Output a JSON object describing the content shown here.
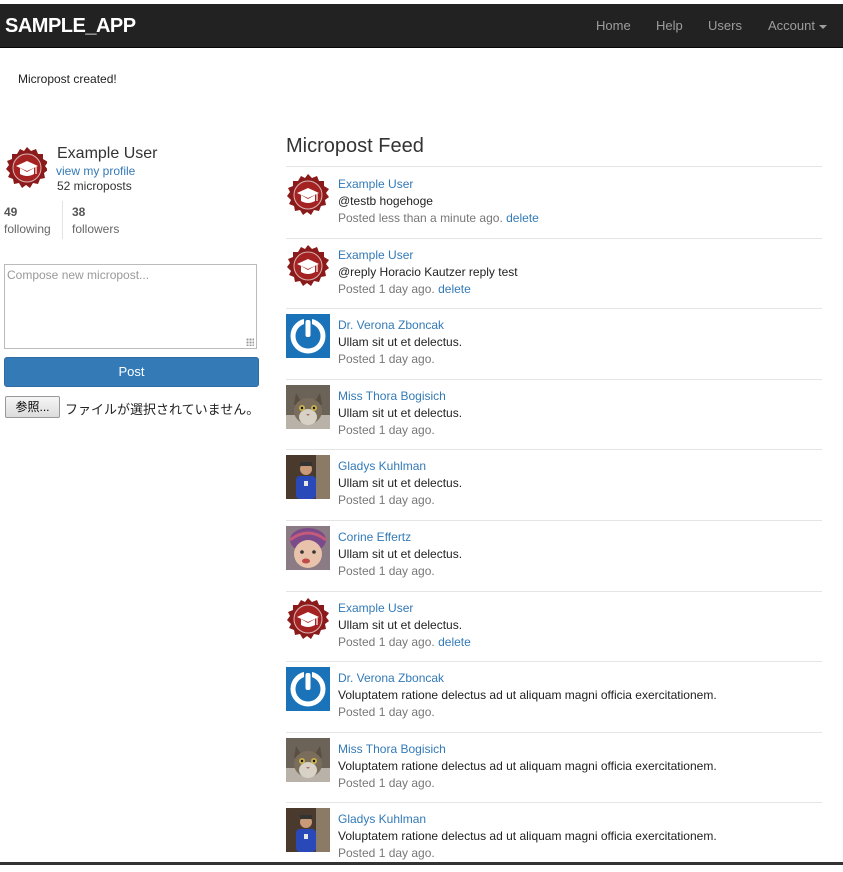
{
  "navbar": {
    "brand": "SAMPLE_APP",
    "links": [
      {
        "label": "Home"
      },
      {
        "label": "Help"
      },
      {
        "label": "Users"
      },
      {
        "label": "Account"
      }
    ]
  },
  "flash": {
    "message": "Micropost created!"
  },
  "profile": {
    "name": "Example User",
    "view_profile": "view my profile",
    "micropost_count": "52 microposts",
    "following_count": "49",
    "following_label": "following",
    "followers_count": "38",
    "followers_label": "followers"
  },
  "compose": {
    "placeholder": "Compose new micropost...",
    "post_label": "Post",
    "file_button_label": "参照...",
    "file_status": "ファイルが選択されていません。"
  },
  "feed": {
    "title": "Micropost Feed",
    "items": [
      {
        "user": "Example User",
        "content": "@testb hogehoge",
        "timestamp": "Posted less than a minute ago.",
        "delete": "delete",
        "avatar": "gravatar-badge-icon"
      },
      {
        "user": "Example User",
        "content": "@reply Horacio Kautzer reply test",
        "timestamp": "Posted 1 day ago.",
        "delete": "delete",
        "avatar": "gravatar-badge-icon"
      },
      {
        "user": "Dr. Verona Zboncak",
        "content": "Ullam sit ut et delectus.",
        "timestamp": "Posted 1 day ago.",
        "avatar": "power-icon"
      },
      {
        "user": "Miss Thora Bogisich",
        "content": "Ullam sit ut et delectus.",
        "timestamp": "Posted 1 day ago.",
        "avatar": "cat-photo"
      },
      {
        "user": "Gladys Kuhlman",
        "content": "Ullam sit ut et delectus.",
        "timestamp": "Posted 1 day ago.",
        "avatar": "person-photo"
      },
      {
        "user": "Corine Effertz",
        "content": "Ullam sit ut et delectus.",
        "timestamp": "Posted 1 day ago.",
        "avatar": "baby-photo"
      },
      {
        "user": "Example User",
        "content": "Ullam sit ut et delectus.",
        "timestamp": "Posted 1 day ago.",
        "delete": "delete",
        "avatar": "gravatar-badge-icon"
      },
      {
        "user": "Dr. Verona Zboncak",
        "content": "Voluptatem ratione delectus ad ut aliquam magni officia exercitationem.",
        "timestamp": "Posted 1 day ago.",
        "avatar": "power-icon"
      },
      {
        "user": "Miss Thora Bogisich",
        "content": "Voluptatem ratione delectus ad ut aliquam magni officia exercitationem.",
        "timestamp": "Posted 1 day ago.",
        "avatar": "cat-photo"
      },
      {
        "user": "Gladys Kuhlman",
        "content": "Voluptatem ratione delectus ad ut aliquam magni officia exercitationem.",
        "timestamp": "Posted 1 day ago.",
        "avatar": "person-photo"
      }
    ]
  },
  "colors": {
    "navbar_bg": "#222222",
    "link": "#337ab7",
    "badge": "#8b1a1a",
    "power_bg": "#1a73b8"
  }
}
